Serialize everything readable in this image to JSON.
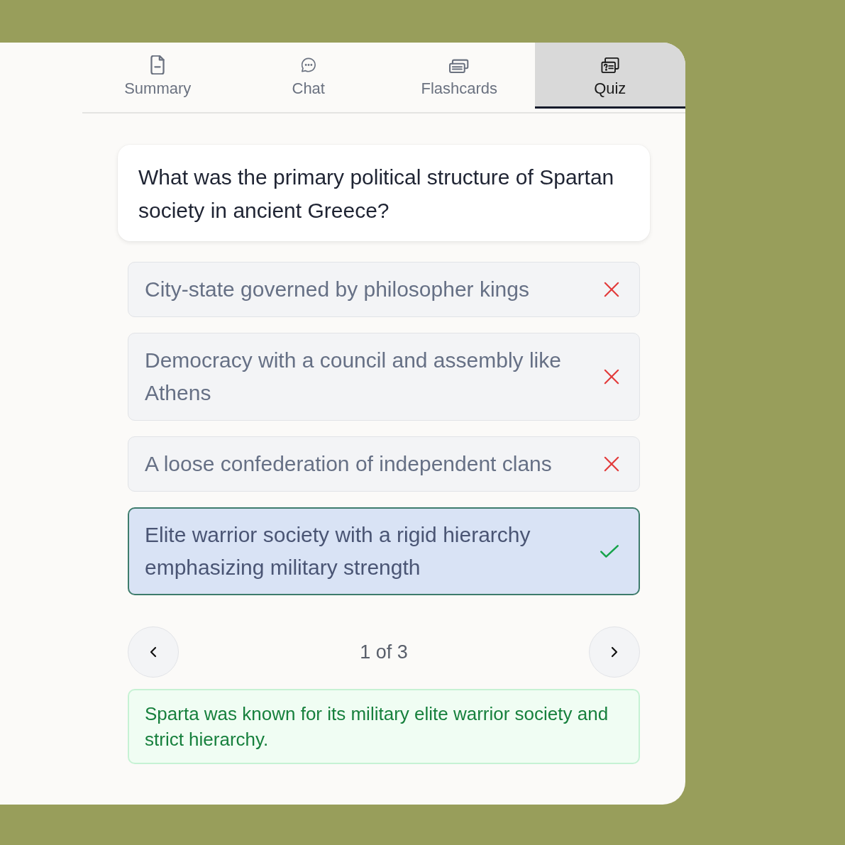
{
  "tabs": [
    {
      "label": "Summary",
      "selected": false
    },
    {
      "label": "Chat",
      "selected": false
    },
    {
      "label": "Flashcards",
      "selected": false
    },
    {
      "label": "Quiz",
      "selected": true
    }
  ],
  "question": {
    "text": "What was the primary political structure of Spartan society in ancient Greece?"
  },
  "options": [
    {
      "text": "City-state governed by philosopher kings",
      "selected": false,
      "correct": false
    },
    {
      "text": "Democracy with a council and assembly like Athens",
      "selected": false,
      "correct": false
    },
    {
      "text": "A loose confederation of independent clans",
      "selected": false,
      "correct": false
    },
    {
      "text": "Elite warrior society with a rigid hierarchy emphasizing military strength",
      "selected": true,
      "correct": true
    }
  ],
  "pager": {
    "label": "1 of 3"
  },
  "explanation": {
    "text": "Sparta was known for its military elite warrior society and strict hierarchy."
  }
}
